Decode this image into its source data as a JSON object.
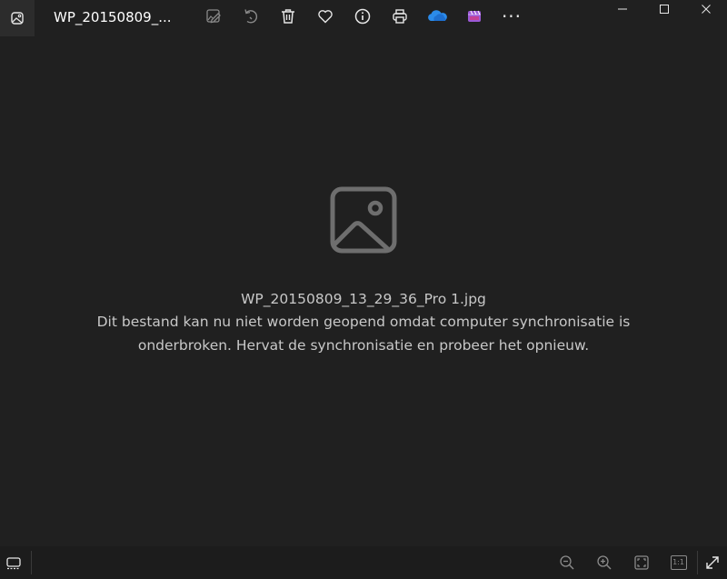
{
  "window": {
    "title": "WP_20150809_..."
  },
  "toolbar": {
    "items": [
      {
        "name": "edit-image-icon"
      },
      {
        "name": "rotate-icon"
      },
      {
        "name": "delete-icon"
      },
      {
        "name": "favorite-heart-icon"
      },
      {
        "name": "info-icon"
      },
      {
        "name": "print-icon"
      },
      {
        "name": "onedrive-cloud-icon"
      },
      {
        "name": "clipchamp-video-icon"
      },
      {
        "name": "more-options-icon"
      }
    ],
    "more_label": "···"
  },
  "message": {
    "filename": "WP_20150809_13_29_36_Pro 1.jpg",
    "line1": "Dit bestand kan nu niet worden geopend omdat computer synchronisatie is",
    "line2": "onderbroken.  Hervat de synchronisatie en probeer het opnieuw."
  },
  "bottom": {
    "zoom_actual_label": "1:1"
  },
  "colors": {
    "background": "#202020",
    "text": "#c8c8c8",
    "icon": "#cfcfcf",
    "onedrive": "#2b8bea",
    "clipchamp": "#9b59d6"
  }
}
